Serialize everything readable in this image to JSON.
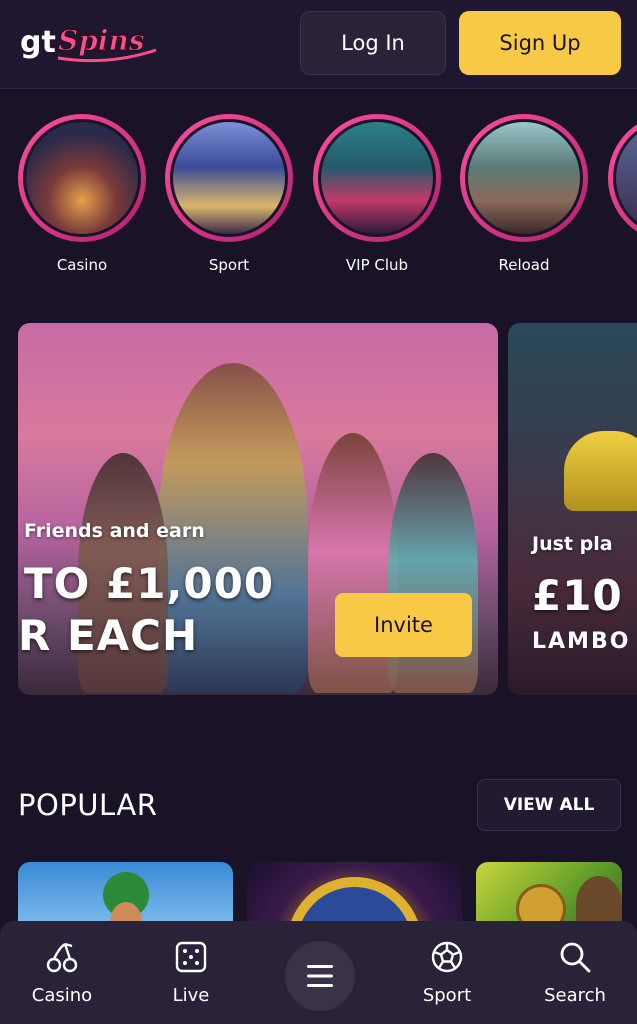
{
  "header": {
    "logo_text": "gtSpins",
    "login_label": "Log In",
    "signup_label": "Sign Up"
  },
  "categories": [
    {
      "label": "Casino"
    },
    {
      "label": "Sport"
    },
    {
      "label": "VIP Club"
    },
    {
      "label": "Reload"
    }
  ],
  "promos": [
    {
      "subtitle": "Friends and earn",
      "headline_line1": "TO £1,000",
      "headline_line2": "R EACH",
      "cta": "Invite"
    },
    {
      "subtitle": "Just pla",
      "headline": "£10",
      "subline": "LAMBO"
    }
  ],
  "popular": {
    "title": "POPULAR",
    "view_all_label": "VIEW ALL"
  },
  "bottom_nav": {
    "items": [
      {
        "label": "Casino",
        "icon": "cherries-icon"
      },
      {
        "label": "Live",
        "icon": "dice-icon"
      },
      {
        "label": "Sport",
        "icon": "soccer-ball-icon"
      },
      {
        "label": "Search",
        "icon": "search-icon"
      }
    ],
    "menu_icon": "hamburger-menu-icon"
  },
  "colors": {
    "background": "#1a1226",
    "accent_yellow": "#f7c945",
    "accent_pink": "#ff4fa0"
  }
}
